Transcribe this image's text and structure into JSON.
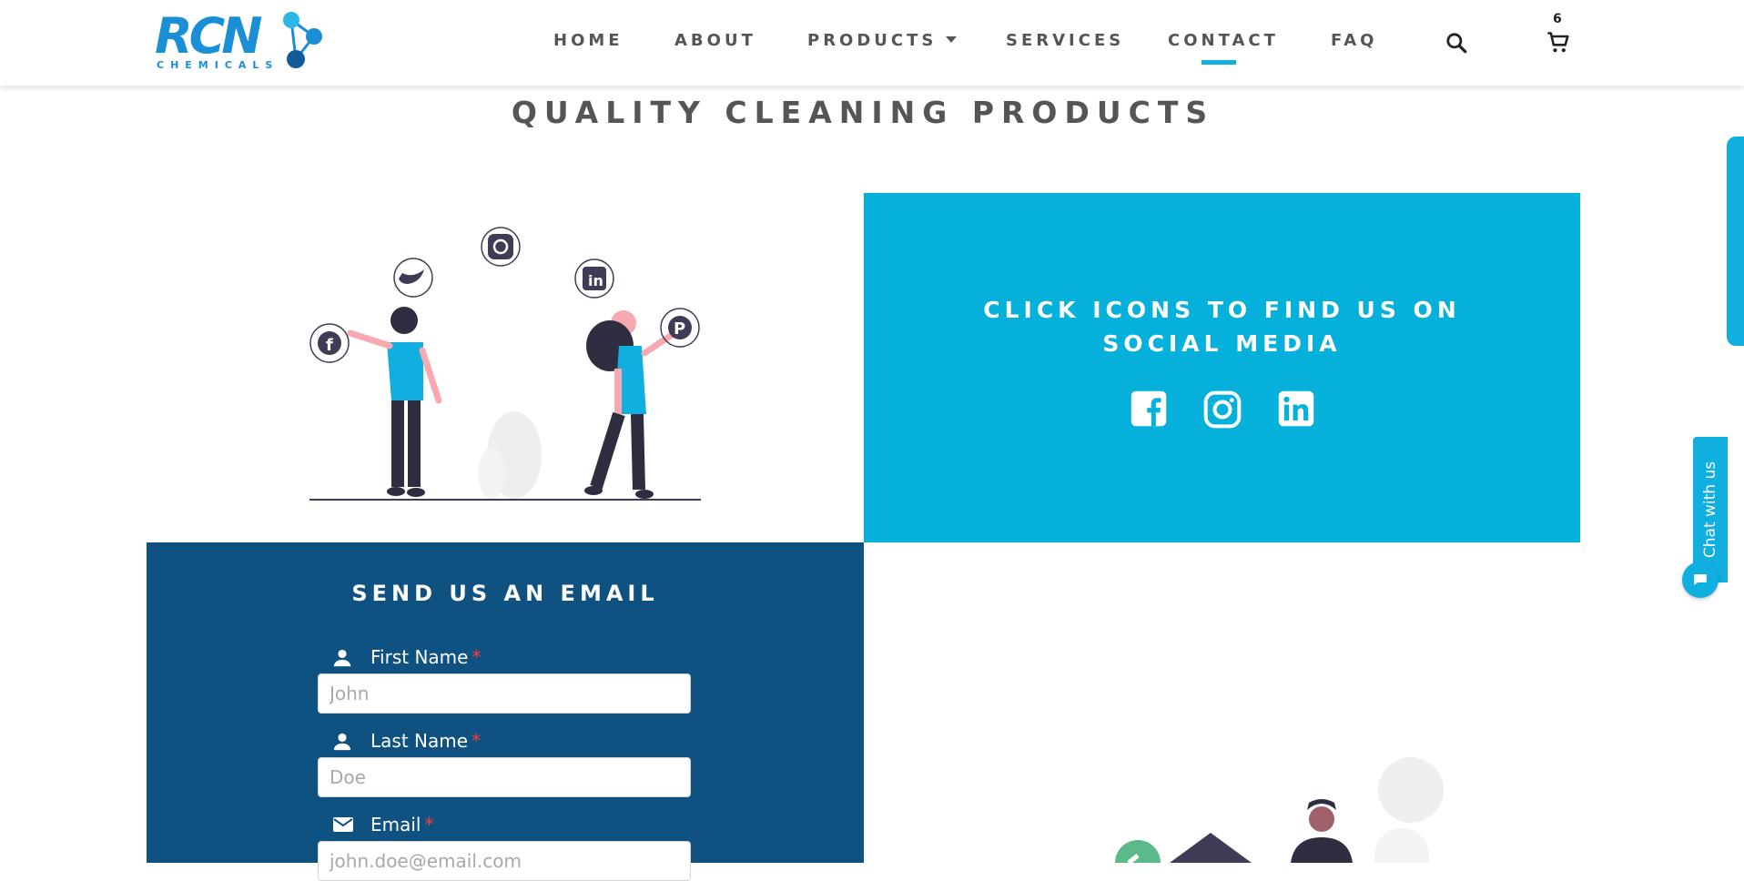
{
  "brand": {
    "logo_text": "RCN",
    "logo_sub": "CHEMICALS",
    "color_primary": "#1a8fd6",
    "color_accent": "#11aee0"
  },
  "nav": {
    "items": [
      {
        "label": "HOME"
      },
      {
        "label": "ABOUT"
      },
      {
        "label": "PRODUCTS"
      },
      {
        "label": "SERVICES"
      },
      {
        "label": "CONTACT"
      },
      {
        "label": "FAQ"
      }
    ],
    "active": "CONTACT",
    "search_icon": "search-icon",
    "cart_icon": "cart-icon",
    "cart_count": "6"
  },
  "page": {
    "title": "QUALITY CLEANING PRODUCTS"
  },
  "social": {
    "heading": "CLICK ICONS TO FIND US ON SOCIAL MEDIA",
    "panel_color": "#05b0db",
    "icons": [
      "facebook-icon",
      "instagram-icon",
      "linkedin-icon"
    ]
  },
  "email_form": {
    "heading": "SEND US AN EMAIL",
    "panel_color": "#0f5281",
    "fields": [
      {
        "label": "First Name",
        "required_mark": "*",
        "placeholder": "John",
        "icon": "person-icon"
      },
      {
        "label": "Last Name",
        "required_mark": "*",
        "placeholder": "Doe",
        "icon": "person-icon"
      },
      {
        "label": "Email",
        "required_mark": "*",
        "placeholder": "john.doe@email.com",
        "icon": "mail-icon"
      }
    ]
  },
  "chat": {
    "tab_label": "Chat with us",
    "bubble_icon": "chat-icon"
  }
}
